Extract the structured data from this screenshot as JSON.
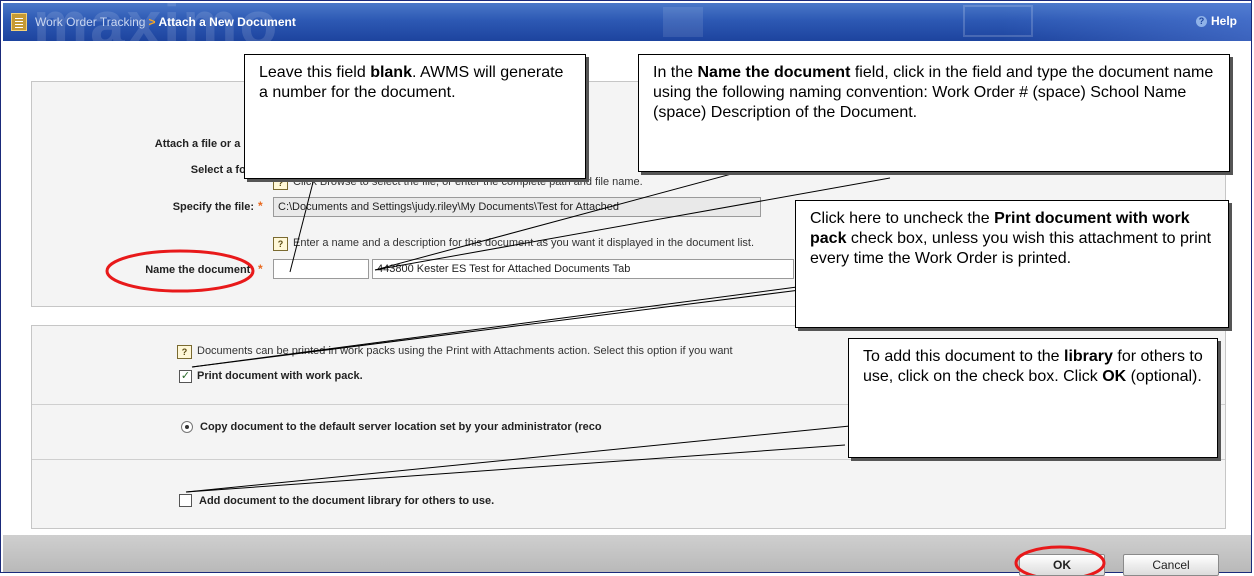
{
  "titlebar": {
    "brand_watermark": "maximo",
    "breadcrumb_parent": "Work Order Tracking",
    "breadcrumb_separator": ">",
    "breadcrumb_current": "Attach a New Document",
    "help_label": "Help"
  },
  "form": {
    "attach_label": "Attach a file or a URL",
    "folder_label": "Select a folder",
    "file_hint": "Click Browse to select the file, or enter the complete path and file name.",
    "specify_file_label": "Specify the file:",
    "file_value": "C:\\Documents and Settings\\judy.riley\\My Documents\\Test for Attached",
    "name_hint": "Enter a name and a description for this document as you want it displayed in the document list.",
    "name_label": "Name the document:",
    "name_value": "",
    "description_value": "443800 Kester ES Test for Attached Documents Tab"
  },
  "options": {
    "print_hint": "Documents can be printed in work packs using the Print with Attachments action. Select this option if you want",
    "print_label": "Print document with work pack.",
    "print_checked": true,
    "copy_label": "Copy document to the default server location set by your administrator (reco",
    "library_label": "Add document to the document library for others to use.",
    "library_checked": false
  },
  "footer": {
    "ok_label": "OK",
    "cancel_label": "Cancel"
  },
  "callouts": {
    "blank_field": {
      "pre": "Leave this field ",
      "bold": "blank",
      "post": ". AWMS will generate a number for the document."
    },
    "name_document": {
      "pre": "In the ",
      "bold": "Name the document",
      "post": " field, click in the field and type the document name using the following naming convention: Work Order # (space) School Name (space) Description of the Document."
    },
    "print_uncheck": {
      "pre": "Click here to uncheck the ",
      "bold": "Print document with work pack",
      "post": " check box, unless you wish this attachment to print every time the Work Order is printed."
    },
    "library_add": {
      "pre": "To add this document to the ",
      "bold": "library",
      "mid": " for others to use, click on the check box.  Click ",
      "bold2": "OK",
      "post": " (optional)."
    }
  },
  "colors": {
    "titlebar": "#2d59b4",
    "accent_orange": "#f6a623",
    "annotation_red": "#e8191a"
  }
}
